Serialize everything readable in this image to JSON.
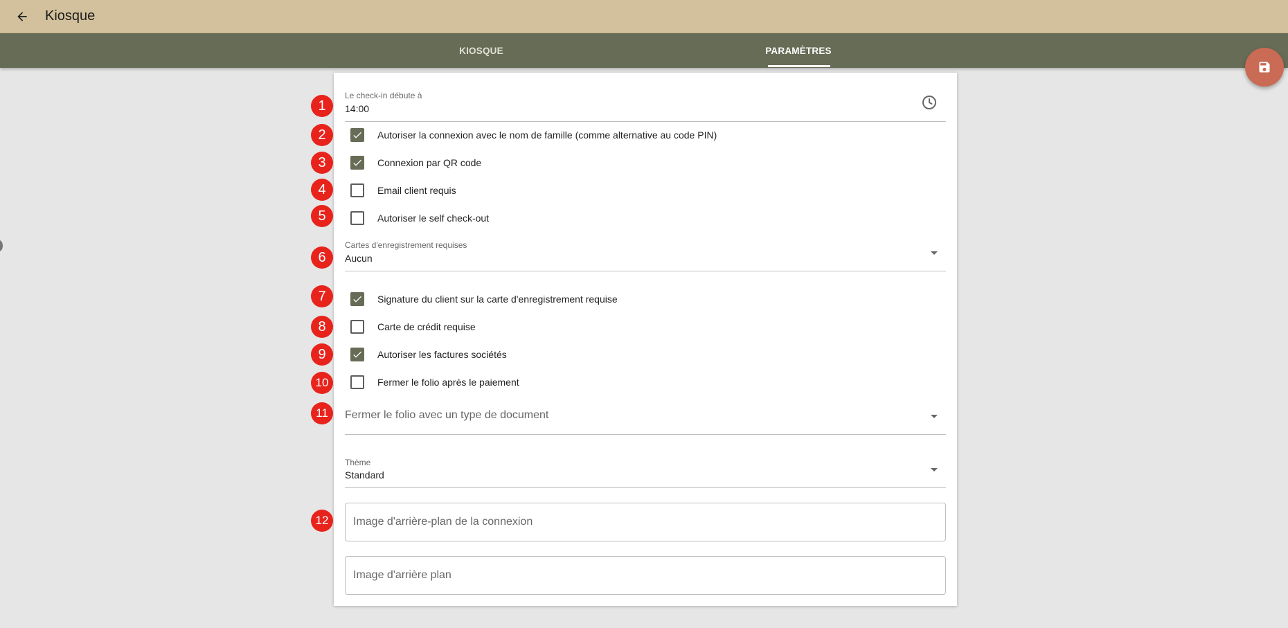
{
  "header": {
    "title": "Kiosque"
  },
  "tabs": [
    {
      "label": "KIOSQUE",
      "active": false
    },
    {
      "label": "PARAMÈTRES",
      "active": true
    }
  ],
  "form": {
    "checkin": {
      "label": "Le check-in débute à",
      "value": "14:00"
    },
    "checkboxes": [
      {
        "label": "Autoriser la connexion avec le nom de famille (comme alternative au code PIN)",
        "checked": true
      },
      {
        "label": "Connexion par QR code",
        "checked": true
      },
      {
        "label": "Email client requis",
        "checked": false
      },
      {
        "label": "Autoriser le self check-out",
        "checked": false
      },
      {
        "label": "Signature du client sur la carte d'enregistrement requise",
        "checked": true
      },
      {
        "label": "Carte de crédit requise",
        "checked": false
      },
      {
        "label": "Autoriser les factures sociétés",
        "checked": true
      },
      {
        "label": "Fermer le folio après le paiement",
        "checked": false
      }
    ],
    "registration_cards": {
      "label": "Cartes d'enregistrement requises",
      "value": "Aucun"
    },
    "close_folio_doc_type": {
      "placeholder": "Fermer le folio avec un type de document"
    },
    "theme": {
      "label": "Thème",
      "value": "Standard"
    },
    "login_background": {
      "placeholder": "Image d'arrière-plan de la connexion"
    },
    "background": {
      "placeholder": "Image d'arrière plan"
    }
  },
  "badges": [
    "1",
    "2",
    "3",
    "4",
    "5",
    "6",
    "7",
    "8",
    "9",
    "10",
    "11",
    "12"
  ],
  "colors": {
    "header_bg": "#d2c19c",
    "tabbar_bg": "#676c56",
    "checkbox_on": "#676c56",
    "fab": "#c96b55",
    "badge": "#e8231c"
  },
  "icons": {
    "back": "arrow-left-icon",
    "clock": "clock-icon",
    "save": "floppy-disk-icon",
    "dropdown": "caret-down-icon"
  }
}
